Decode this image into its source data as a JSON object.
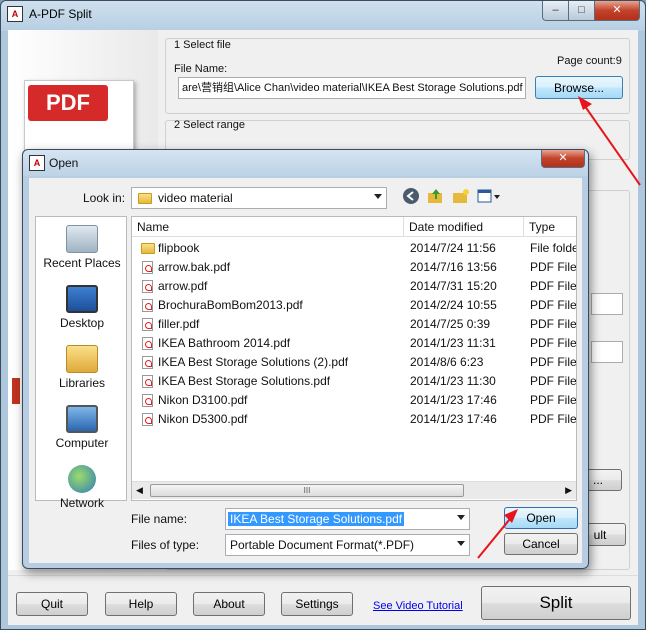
{
  "window": {
    "title": "A-PDF Split",
    "minimize": "–",
    "maximize": "□",
    "close": "✕"
  },
  "left_panel": {
    "logo_text": "PDF"
  },
  "section1": {
    "header": "1 Select file",
    "page_count": "Page count:9",
    "file_name_label": "File Name:",
    "file_path": "are\\营销组\\Alice Chan\\video material\\IKEA Best Storage Solutions.pdf",
    "browse_label": "Browse..."
  },
  "section2": {
    "header": "2 Select range"
  },
  "right_buttons": {
    "ellipsis": "...",
    "result": "ult"
  },
  "bottom": {
    "quit": "Quit",
    "help": "Help",
    "about": "About",
    "settings": "Settings",
    "tutorial_link": "See Video Tutorial",
    "split": "Split"
  },
  "dialog": {
    "title": "Open",
    "close": "✕",
    "look_in_label": "Look in:",
    "look_in_value": "video material",
    "places": [
      "Recent Places",
      "Desktop",
      "Libraries",
      "Computer",
      "Network"
    ],
    "columns": [
      "Name",
      "Date modified",
      "Type"
    ],
    "files": [
      {
        "name": "flipbook",
        "date": "2014/7/24 11:56",
        "type": "File folder",
        "kind": "folder"
      },
      {
        "name": "arrow.bak.pdf",
        "date": "2014/7/16 13:56",
        "type": "PDF File",
        "kind": "pdf"
      },
      {
        "name": "arrow.pdf",
        "date": "2014/7/31 15:20",
        "type": "PDF File",
        "kind": "pdf"
      },
      {
        "name": "BrochuraBomBom2013.pdf",
        "date": "2014/2/24 10:55",
        "type": "PDF File",
        "kind": "pdf"
      },
      {
        "name": "filler.pdf",
        "date": "2014/7/25 0:39",
        "type": "PDF File",
        "kind": "pdf"
      },
      {
        "name": "IKEA Bathroom 2014.pdf",
        "date": "2014/1/23 11:31",
        "type": "PDF File",
        "kind": "pdf"
      },
      {
        "name": "IKEA Best Storage Solutions (2).pdf",
        "date": "2014/8/6 6:23",
        "type": "PDF File",
        "kind": "pdf"
      },
      {
        "name": "IKEA Best Storage Solutions.pdf",
        "date": "2014/1/23 11:30",
        "type": "PDF File",
        "kind": "pdf"
      },
      {
        "name": "Nikon D3100.pdf",
        "date": "2014/1/23 17:46",
        "type": "PDF File",
        "kind": "pdf"
      },
      {
        "name": "Nikon D5300.pdf",
        "date": "2014/1/23 17:46",
        "type": "PDF File",
        "kind": "pdf"
      }
    ],
    "scroll_grip": "III",
    "file_name_label": "File name:",
    "file_name_value": "IKEA Best Storage Solutions.pdf",
    "file_type_label": "Files of type:",
    "file_type_value": "Portable Document Format(*.PDF)",
    "open_button": "Open",
    "cancel_button": "Cancel"
  },
  "colors": {
    "annotation_arrow": "#e8141b",
    "selection": "#3399ff",
    "pdf_red": "#d62a2a"
  }
}
